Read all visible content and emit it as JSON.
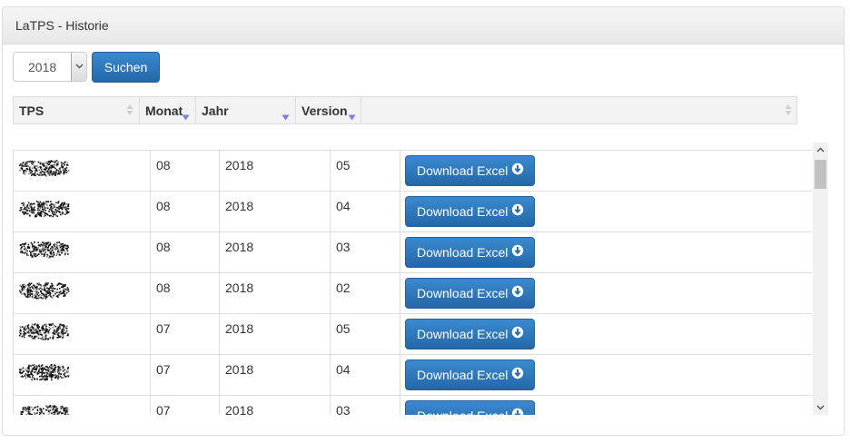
{
  "panel": {
    "title": "LaTPS - Historie"
  },
  "filter": {
    "year_value": "2018",
    "search_label": "Suchen"
  },
  "table": {
    "headers": [
      "TPS",
      "Monat",
      "Jahr",
      "Version",
      ""
    ],
    "download_label": "Download Excel",
    "rows": [
      {
        "monat": "08",
        "jahr": "2018",
        "version": "05"
      },
      {
        "monat": "08",
        "jahr": "2018",
        "version": "04"
      },
      {
        "monat": "08",
        "jahr": "2018",
        "version": "03"
      },
      {
        "monat": "08",
        "jahr": "2018",
        "version": "02"
      },
      {
        "monat": "07",
        "jahr": "2018",
        "version": "05"
      },
      {
        "monat": "07",
        "jahr": "2018",
        "version": "04"
      },
      {
        "monat": "07",
        "jahr": "2018",
        "version": "03"
      }
    ]
  },
  "colors": {
    "primary": "#2f7bc4",
    "header_bg": "#f3f3f3",
    "border": "#dddddd",
    "sort_icon": "#7b7fe0"
  }
}
